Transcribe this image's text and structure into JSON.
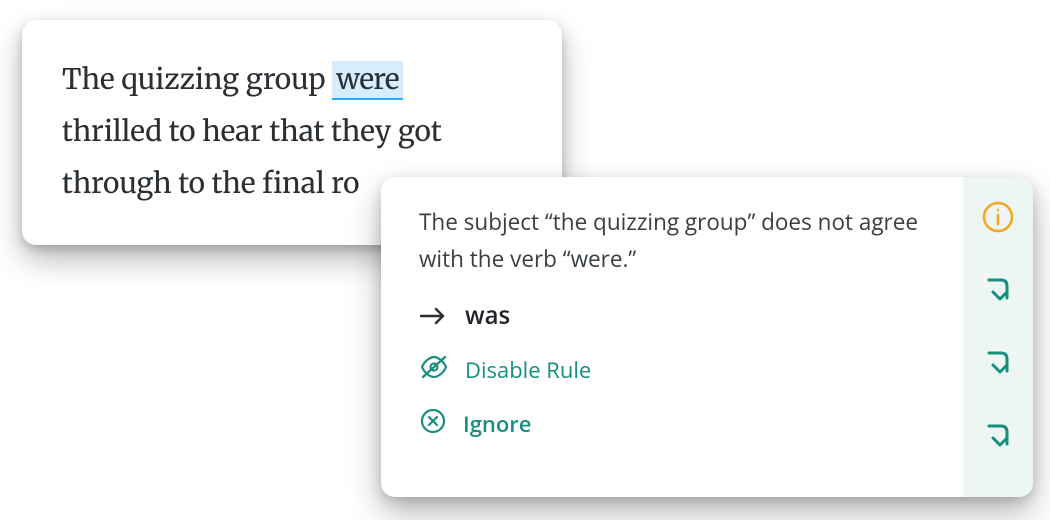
{
  "editor": {
    "line1_pre": "The quizzing group ",
    "highlight": "were",
    "line2": "thrilled to hear that they got",
    "line3": "through to the final ro"
  },
  "suggestion": {
    "explanation": "The subject “the quizzing group” does not agree with the verb “were.”",
    "suggested_word": "was",
    "disable_label": "Disable Rule",
    "ignore_label": "Ignore"
  },
  "colors": {
    "teal": "#188e80",
    "orange": "#f5a623",
    "highlight_bg": "#d6ecff",
    "highlight_underline": "#2aa8ff"
  }
}
